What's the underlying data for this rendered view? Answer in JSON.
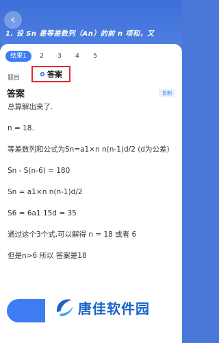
{
  "header": {
    "question": "1. 设 Sn 是等差数列（An）的前 n 项和，又",
    "back_icon": "chevron-left-icon"
  },
  "tabs": [
    "结果1",
    "2",
    "3",
    "4",
    "5"
  ],
  "section_tabs": {
    "question_label": "题目",
    "answer_label": "答案"
  },
  "answer": {
    "heading": "答案",
    "copy_label": "复制",
    "lines": [
      "总算解出来了.",
      "",
      "n = 18.",
      "",
      "等差数列和公式为Sn=a1×n n(n-1)d/2 (d为公差)",
      "",
      "Sn - S(n-6) = 180",
      "",
      "Sn = a1×n n(n-1)d/2",
      "",
      "S6 = 6a1 15d = 35",
      "",
      "通过这个3个式,可以解得 n = 18 或者 6",
      "",
      "但是n>6 所以 答案是18"
    ]
  },
  "watermark": {
    "text": "唐佳软件园"
  },
  "colors": {
    "accent": "#3e7cf3",
    "highlight_border": "#e5262b",
    "header_bg": "#4a78d8"
  }
}
